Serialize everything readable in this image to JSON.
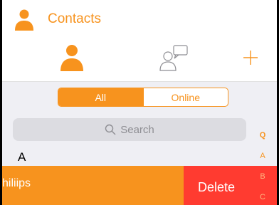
{
  "colors": {
    "accent": "#f7931e",
    "delete": "#ff3b30",
    "background": "#efeff4"
  },
  "header": {
    "title": "Contacts",
    "icons": {
      "app": "contacts-person-icon",
      "tab_contacts": "person-icon",
      "tab_messages": "person-chat-icon",
      "add": "plus-icon"
    }
  },
  "segmented": {
    "all_label": "All",
    "online_label": "Online",
    "selected": "All"
  },
  "search": {
    "placeholder": "Search",
    "icon": "search-icon"
  },
  "section": {
    "header": "A"
  },
  "index": [
    "Q",
    "A",
    "B",
    "C"
  ],
  "row": {
    "name": "hiliips",
    "delete_label": "Delete"
  }
}
